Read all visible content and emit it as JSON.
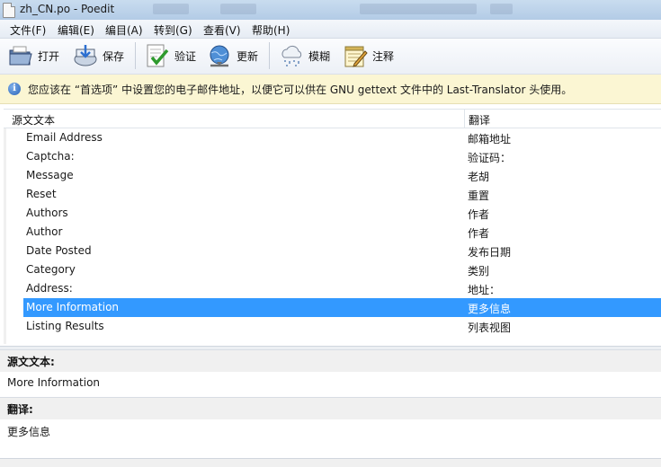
{
  "window": {
    "title": "zh_CN.po - Poedit"
  },
  "menu": [
    {
      "id": "file",
      "label": "文件(F)"
    },
    {
      "id": "edit",
      "label": "编辑(E)"
    },
    {
      "id": "catalog",
      "label": "编目(A)"
    },
    {
      "id": "goto",
      "label": "转到(G)"
    },
    {
      "id": "view",
      "label": "查看(V)"
    },
    {
      "id": "help",
      "label": "帮助(H)"
    }
  ],
  "toolbar": {
    "open": {
      "label": "打开",
      "icon": "open-folder-icon"
    },
    "save": {
      "label": "保存",
      "icon": "save-icon"
    },
    "validate": {
      "label": "验证",
      "icon": "validate-icon"
    },
    "update": {
      "label": "更新",
      "icon": "update-globe-icon"
    },
    "fuzzy": {
      "label": "模糊",
      "icon": "fuzzy-cloud-icon"
    },
    "comment": {
      "label": "注释",
      "icon": "comment-notepad-icon"
    }
  },
  "infobar": {
    "icon": "info-icon",
    "text": "您应该在 “首选项” 中设置您的电子邮件地址，以便它可以供在 GNU gettext 文件中的 Last-Translator 头使用。"
  },
  "list": {
    "headers": {
      "source": "源文文本",
      "translation": "翻译"
    },
    "rows": [
      {
        "source": "Email Address",
        "translation": "邮箱地址"
      },
      {
        "source": "Captcha:",
        "translation": "验证码："
      },
      {
        "source": "Message",
        "translation": "老胡"
      },
      {
        "source": "Reset",
        "translation": "重置"
      },
      {
        "source": "Authors",
        "translation": "作者"
      },
      {
        "source": "Author",
        "translation": "作者"
      },
      {
        "source": "Date Posted",
        "translation": "发布日期"
      },
      {
        "source": "Category",
        "translation": "类别"
      },
      {
        "source": "Address:",
        "translation": "地址："
      },
      {
        "source": "More Information",
        "translation": "更多信息",
        "selected": true
      },
      {
        "source": "Listing Results",
        "translation": "列表视图"
      }
    ]
  },
  "source_panel": {
    "label": "源文文本:",
    "text": "More Information"
  },
  "translation_panel": {
    "label": "翻译:",
    "text": "更多信息"
  },
  "colors": {
    "selection": "#3399ff",
    "infobar_bg": "#fbf6d3"
  }
}
